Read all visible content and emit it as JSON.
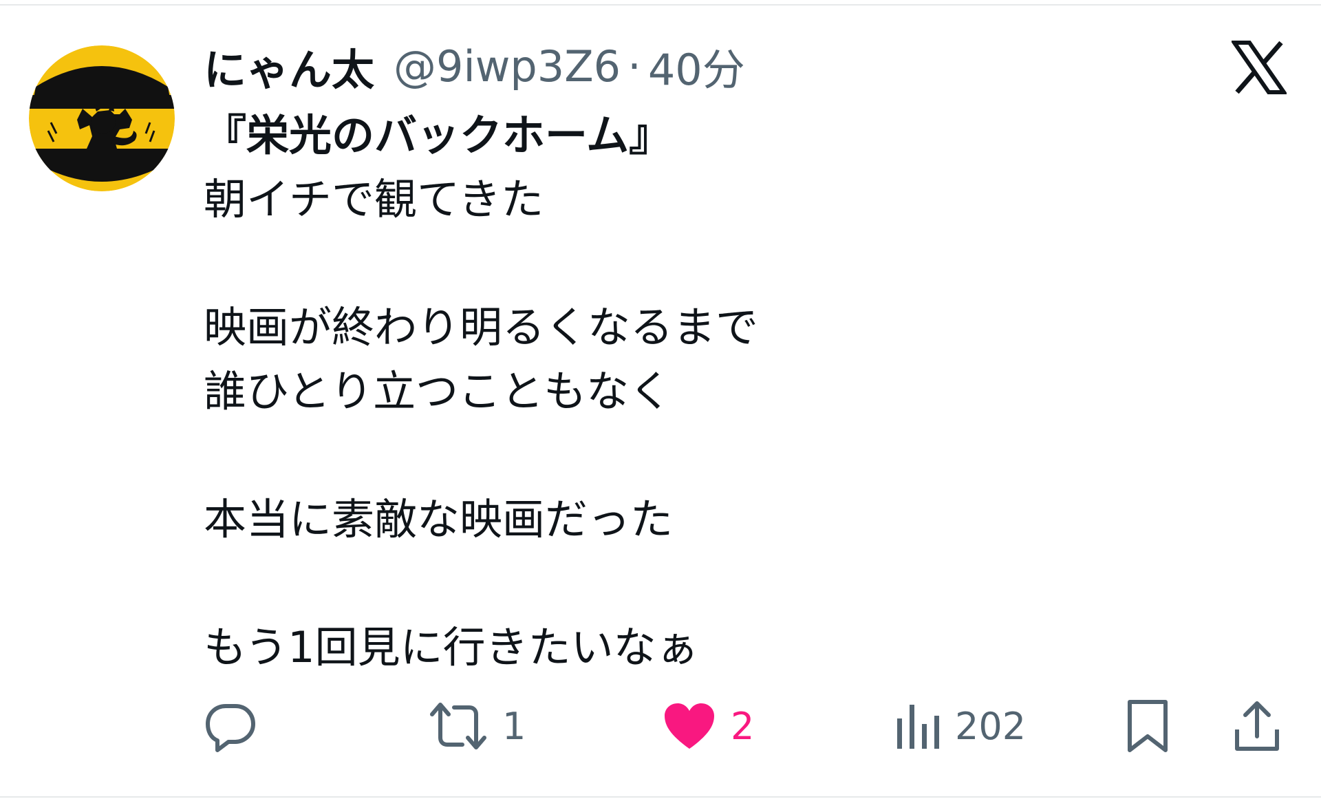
{
  "user": {
    "display_name": "にゃん太",
    "handle": "@9iwp3Z6",
    "separator": "·",
    "time": "40分",
    "avatar": "cat-silhouette-avatar",
    "avatar_color": "#f5c20e"
  },
  "brand": {
    "logo": "x-logo-icon"
  },
  "post": {
    "lines": [
      "『栄光のバックホーム』",
      "朝イチで観てきた",
      "",
      "映画が終わり明るくなるまで",
      "誰ひとり立つこともなく",
      "",
      "本当に素敵な映画だった",
      "",
      "もう1回見に行きたいなぁ"
    ]
  },
  "actions": {
    "reply": {
      "icon": "reply-icon",
      "count": ""
    },
    "repost": {
      "icon": "repost-icon",
      "count": "1"
    },
    "like": {
      "icon": "heart-icon",
      "count": "2",
      "liked": true,
      "color": "#f91880"
    },
    "views": {
      "icon": "views-chart-icon",
      "count": "202"
    },
    "bookmark": {
      "icon": "bookmark-icon"
    },
    "share": {
      "icon": "share-icon"
    }
  },
  "colors": {
    "text": "#0f1419",
    "muted": "#536471",
    "divider": "#e7e9ea"
  }
}
